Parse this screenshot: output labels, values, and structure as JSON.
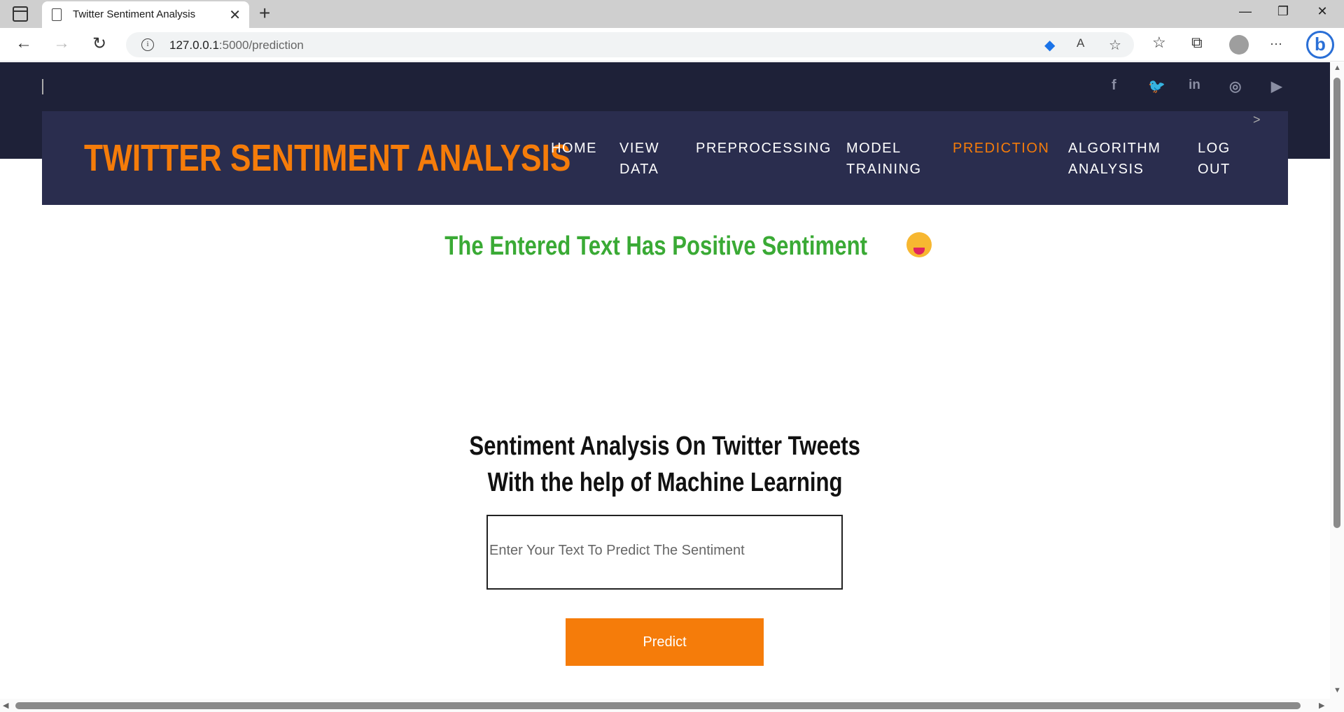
{
  "browser": {
    "tab_title": "Twitter Sentiment Analysis",
    "tab_close": "✕",
    "new_tab": "+",
    "url_host": "127.0.0.1",
    "url_path": ":5000/prediction",
    "minimize": "—",
    "restore": "❐",
    "close": "✕",
    "back": "←",
    "forward": "→",
    "reload": "↻",
    "more": "···"
  },
  "site": {
    "brand": "TWITTER SENTIMENT ANALYSIS",
    "social_icons": [
      "facebook-icon",
      "twitter-icon",
      "linkedin-icon",
      "instagram-icon",
      "youtube-icon"
    ],
    "social_glyphs": [
      "f",
      "🐦",
      "in",
      "◎",
      "▶"
    ],
    "menu": [
      {
        "line1": "HOME",
        "line2": ""
      },
      {
        "line1": "VIEW",
        "line2": "DATA"
      },
      {
        "line1": "PREPROCESSING",
        "line2": ""
      },
      {
        "line1": "MODEL",
        "line2": "TRAINING"
      },
      {
        "line1": "PREDICTION",
        "line2": "",
        "active": true
      },
      {
        "line1": "ALGORITHM",
        "line2": "ANALYSIS"
      },
      {
        "line1": "LOG",
        "line2": "OUT"
      }
    ],
    "nav_next": ">"
  },
  "main": {
    "result_text": "The Entered Text Has Positive Sentiment",
    "result_color": "#3aaa35",
    "heading_line1": "Sentiment Analysis On Twitter Tweets",
    "heading_line2": "With the help of Machine Learning",
    "input_placeholder": "Enter Your Text To Predict The Sentiment",
    "predict_label": "Predict",
    "accent_color": "#f57c0a"
  }
}
